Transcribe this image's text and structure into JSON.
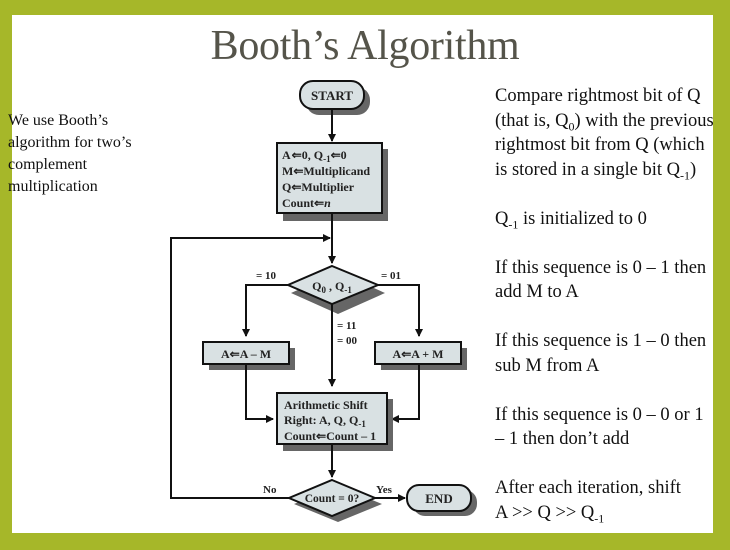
{
  "slide": {
    "title": "Booth’s Algorithm",
    "left_note": "We use Booth’s algorithm for two’s complement multiplication",
    "colors": {
      "frame": "#a6b729",
      "title": "#55544a",
      "box_fill": "#d9e1e3",
      "shadow": "#666666"
    }
  },
  "flowchart": {
    "start": "START",
    "init_lines": [
      "A ⇐ 0, Q-1 ⇐ 0",
      "M ⇐ Multiplicand",
      "Q ⇐ Multiplier",
      "Count ⇐ n"
    ],
    "init": {
      "line1_a": "A",
      "line1_b": "0, Q",
      "line1_sub": "-1",
      "line1_c": "0",
      "line2_a": "M",
      "line2_b": "Multiplicand",
      "line3_a": "Q",
      "line3_b": "Multiplier",
      "line4_a": "Count",
      "line4_b": "n"
    },
    "decision1": {
      "q0": "Q",
      "q0_sub": "0",
      "sep": " , Q",
      "qm1_sub": "-1"
    },
    "branch_left_label": "= 10",
    "branch_right_label": "= 01",
    "branch_mid_label_1": "= 11",
    "branch_mid_label_2": "= 00",
    "sub_box": {
      "a": "A",
      "b": "A – M"
    },
    "add_box": {
      "a": "A",
      "b": "A + M"
    },
    "shift_box": {
      "line1": "Arithmetic Shift",
      "line2": "Right: A, Q, Q",
      "line2_sub": "-1",
      "line3_a": "Count",
      "line3_b": "Count – 1"
    },
    "decision2": "Count = 0?",
    "no_label": "No",
    "yes_label": "Yes",
    "end": "END"
  },
  "explanation": {
    "p1_a": "Compare rightmost bit of Q (that is, Q",
    "p1_sub1": "0",
    "p1_b": ") with the previous rightmost bit from Q (which is stored in a single bit Q",
    "p1_sub2": "-1",
    "p1_c": ")",
    "p2_a": "Q",
    "p2_sub": "-1",
    "p2_b": " is initialized to 0",
    "p3": "If this sequence is 0 – 1 then add M to A",
    "p4": "If this sequence is 1 – 0 then sub M from A",
    "p5": "If this sequence is 0 – 0 or 1 – 1 then don’t add",
    "p6_a": "After each iteration, shift",
    "p6_b": "A >> Q >> Q",
    "p6_sub": "-1"
  }
}
